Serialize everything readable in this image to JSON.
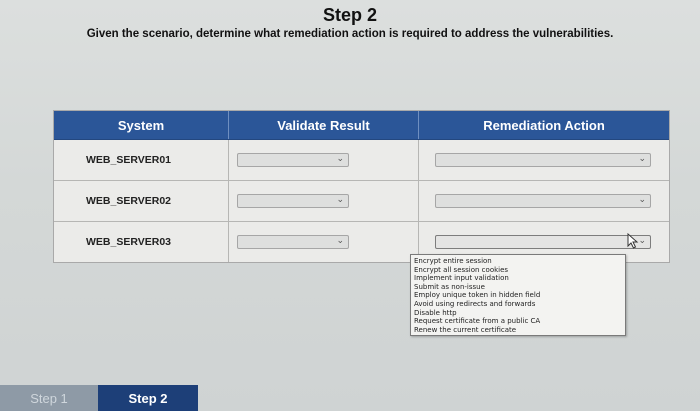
{
  "header": {
    "title": "Step 2",
    "instructions": "Given the scenario, determine what remediation action is required to address the vulnerabilities."
  },
  "table": {
    "columns": [
      "System",
      "Validate Result",
      "Remediation Action"
    ],
    "rows": [
      {
        "system": "WEB_SERVER01",
        "validate_result": "",
        "remediation_action": ""
      },
      {
        "system": "WEB_SERVER02",
        "validate_result": "",
        "remediation_action": ""
      },
      {
        "system": "WEB_SERVER03",
        "validate_result": "",
        "remediation_action": ""
      }
    ]
  },
  "dropdown": {
    "options": [
      "Encrypt entire session",
      "Encrypt all session cookies",
      "Implement input validation",
      "Submit as non-issue",
      "Employ unique token in hidden field",
      "Avoid using redirects and forwards",
      "Disable http",
      "Request certificate from a public CA",
      "Renew the current certificate"
    ]
  },
  "footer": {
    "tabs": [
      {
        "label": "Step 1"
      },
      {
        "label": "Step 2"
      }
    ],
    "active_tab": "Step 2"
  },
  "colors": {
    "header_bg": "#2b5698",
    "active_tab_bg": "#1d3f78",
    "inactive_tab_bg": "#8e9aa6"
  },
  "icons": {
    "select_chevron": "chevron-down-icon",
    "cursor": "mouse-pointer-icon"
  }
}
